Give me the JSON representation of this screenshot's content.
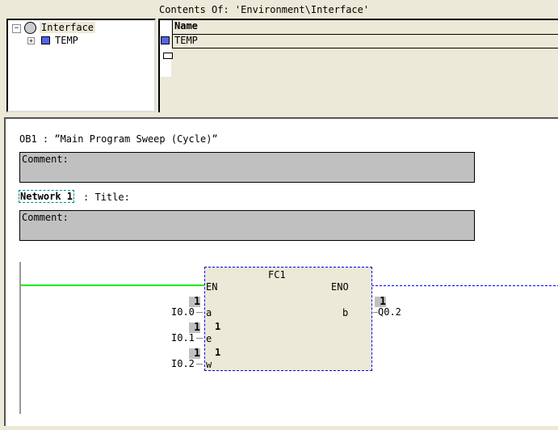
{
  "tree": {
    "root": "Interface",
    "child": "TEMP"
  },
  "contents": {
    "title": "Contents Of: 'Environment\\Interface'",
    "column": "Name",
    "rows": [
      "TEMP"
    ]
  },
  "editor": {
    "block_title": "OB1 :  ”Main Program Sweep (Cycle)”",
    "block_comment": "Comment:",
    "network_label": "Network 1",
    "network_title": ": Title:",
    "network_comment": "Comment:",
    "fc": {
      "name": "FC1",
      "en": "EN",
      "eno": "ENO",
      "inputs": [
        {
          "pin": "a",
          "operand": "I0.0",
          "status": "1"
        },
        {
          "pin": "e",
          "operand": "I0.1",
          "status": "1",
          "value": "1"
        },
        {
          "pin": "w",
          "operand": "I0.2",
          "status": "1",
          "value": "1"
        }
      ],
      "outputs": [
        {
          "pin": "b",
          "operand": "Q0.2",
          "status": "1"
        }
      ]
    }
  },
  "colors": {
    "power_flow": "#00ee00",
    "box_bg": "#ece9d8",
    "selection": "#0000ff"
  }
}
